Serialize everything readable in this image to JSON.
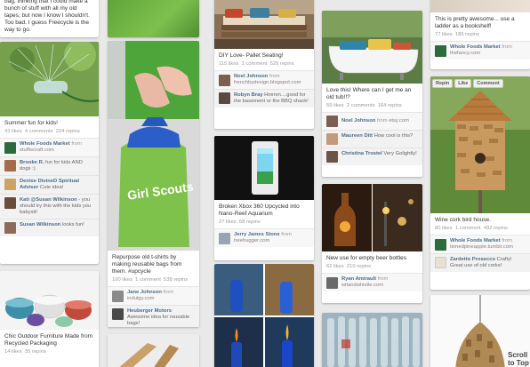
{
  "scroll_to_top": "Scroll to Top",
  "pins": {
    "col1_top": {
      "desc": "bag, thinking that I could make a bunch of stuff with all my old tapes, but now I know I shouldn't. Too bad. I guess Freecycle is the way to go."
    },
    "sprinkler": {
      "desc": "Summer fun for kids!",
      "likes": "43 likes",
      "comments": "4 comments",
      "repins": "224 repins",
      "source_name": "Whole Foods Market",
      "source_from": "from",
      "source_site": "stuffiscraft.com",
      "comments_list": [
        {
          "name": "Brooke R.",
          "text": "fun for kids AND dogs :)"
        },
        {
          "name": "Denise DivineD Spiritual Adviser",
          "text": "Cute idea!"
        },
        {
          "name": "Kati @Susan Wilkinson",
          "text": "- you should try this with the kids you babysit!"
        },
        {
          "name": "Susan Wilkinson",
          "text": "looks fun!"
        }
      ]
    },
    "outdoor": {
      "desc": "Chic Outdoor Furniture Made from Recycled Packaging",
      "likes": "14 likes",
      "repins": "35 repins"
    },
    "girlscouts": {
      "desc": "Repurpose old t-shirts by making reusable bags from them. #upcycle",
      "likes": "100 likes",
      "comments": "1 comment",
      "repins": "538 repins",
      "source_name": "Jane Johnson",
      "source_from": "from",
      "source_site": "indulgy.com",
      "comments_list": [
        {
          "name": "Heuberger Motors",
          "text": "Awesome idea for reusable bags!"
        }
      ]
    },
    "pallet": {
      "desc": "DIY Love- Pallet Seating!",
      "likes": "115 likes",
      "comments": "1 comment",
      "repins": "529 repins",
      "source_name": "Noel Johnson",
      "source_from": "from",
      "source_site": "frenchbydesign.blogspot.com",
      "comments_list": [
        {
          "name": "Robyn Bray",
          "text": "Hmmm....good for the basement or the BBQ shack!"
        }
      ]
    },
    "xbox": {
      "desc": "Broken Xbox 360 Upcycled into Nano-Reef Aquarium",
      "likes": "27 likes",
      "repins": "58 repins",
      "source_name": "Jerry James Stone",
      "source_from": "from",
      "source_site": "treehugger.com"
    },
    "tub": {
      "desc": "Love this! Where can I get me an old tub!!?",
      "likes": "59 likes",
      "comments": "2 comments",
      "repins": "164 repins",
      "source_name": "Noel Johnson",
      "source_from": "from",
      "source_site": "etsy.com",
      "comments_list": [
        {
          "name": "Maureen Ditt",
          "text": "How cool is this?"
        },
        {
          "name": "Christina Trostel",
          "text": "Very Golightly!"
        }
      ]
    },
    "bottles": {
      "desc": "New use for empty beer bottles",
      "likes": "62 likes",
      "repins": "210 repins",
      "source_name": "Ryan Amirault",
      "source_from": "from",
      "source_site": "witandwhistle.com"
    },
    "ladder": {
      "desc": "This is pretty awesome... use a ladder as a bookshelf!",
      "likes": "77 likes",
      "repins": "186 repins",
      "source_name": "Whole Foods Market",
      "source_from": "from",
      "source_site": "thefancy.com"
    },
    "birdhouse": {
      "desc": "Wine cork bird house.",
      "likes": "80 likes",
      "comments": "1 comment",
      "repins": "432 repins",
      "source_name": "Whole Foods Market",
      "source_from": "from",
      "source_site": "tinnedpineapple.tumblr.com",
      "actions": [
        "Repin",
        "Like",
        "Comment"
      ],
      "comments_list": [
        {
          "name": "Zardetto Prosecco",
          "text": "Crafty! Great use of old corks!"
        }
      ]
    }
  }
}
